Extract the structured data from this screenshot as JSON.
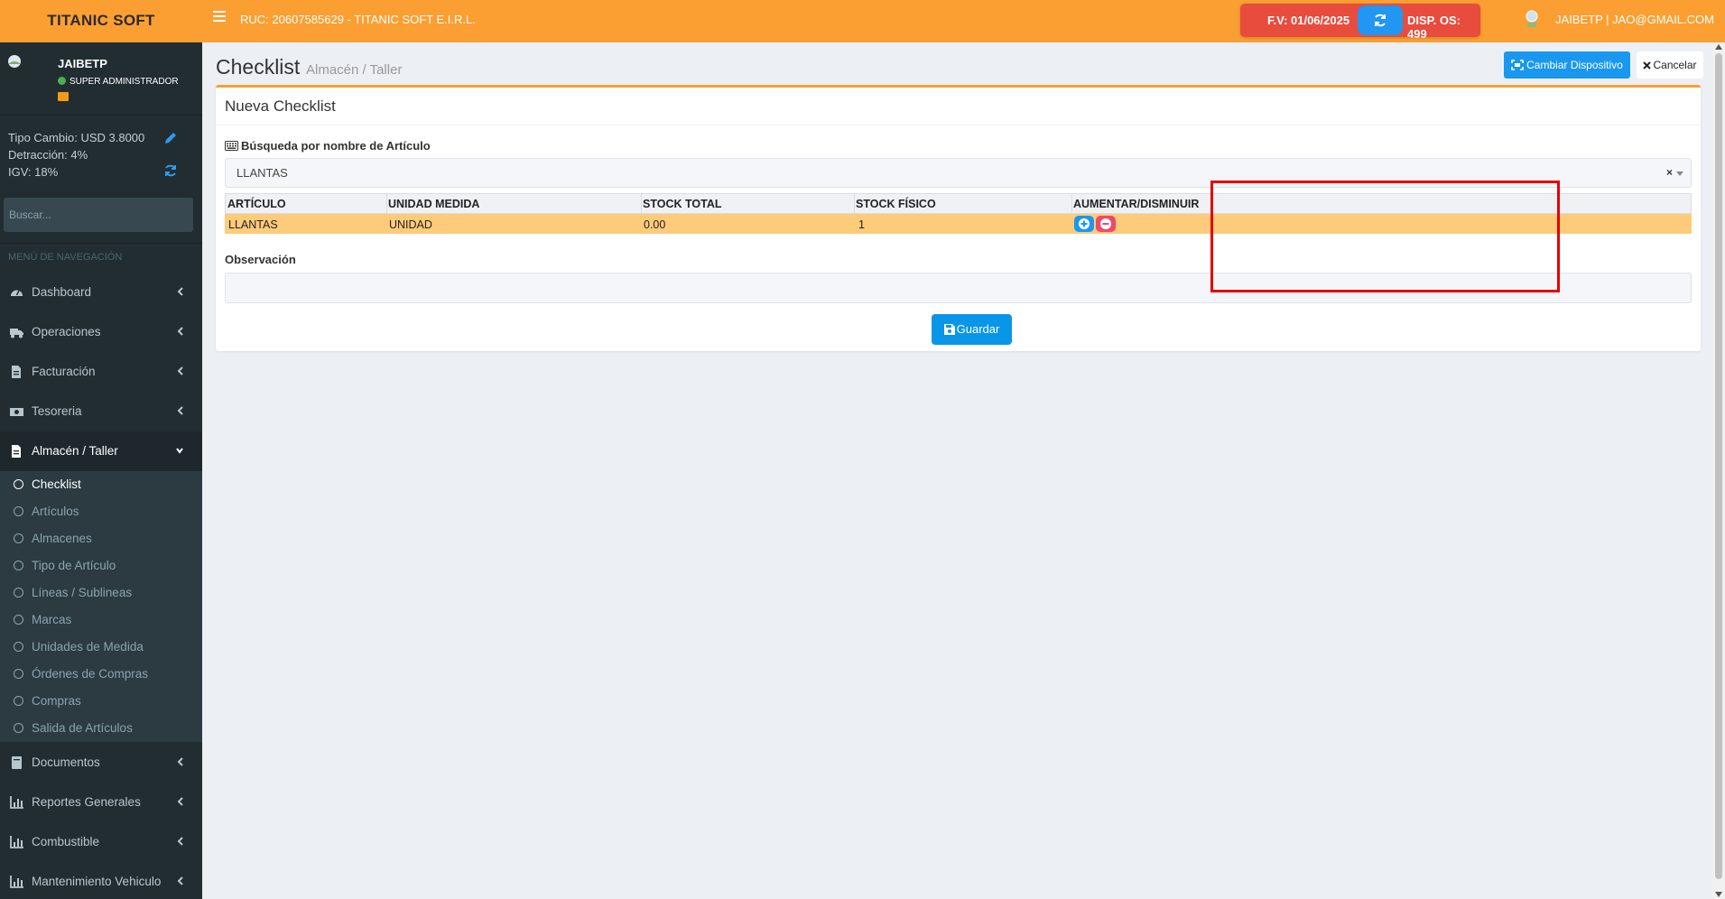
{
  "header": {
    "logo": "TITANIC SOFT",
    "ruc_text": "RUC: 20607585629 - TITANIC SOFT E.I.R.L.",
    "fv_text": "F.V:  01/06/2025",
    "disp_text": "DISP. OS:  499",
    "user_text": "JAIBETP | JAO@GMAIL.COM"
  },
  "sidebar": {
    "user_name": "JAIBETP",
    "user_role": "SUPER ADMINISTRADOR",
    "tipo_cambio": "Tipo Cambio: USD 3.8000",
    "detraccion": "Detracción: 4%",
    "igv": "IGV: 18%",
    "search_placeholder": "Buscar...",
    "nav_header": "MENÚ DE NAVEGACIÓN",
    "items": [
      {
        "label": "Dashboard",
        "icon": "dashboard-icon"
      },
      {
        "label": "Operaciones",
        "icon": "truck-icon"
      },
      {
        "label": "Facturación",
        "icon": "file-icon"
      },
      {
        "label": "Tesoreria",
        "icon": "money-icon"
      },
      {
        "label": "Almacén / Taller",
        "icon": "file-icon"
      },
      {
        "label": "Documentos",
        "icon": "book-icon"
      },
      {
        "label": "Reportes Generales",
        "icon": "chart-icon"
      },
      {
        "label": "Combustible",
        "icon": "chart-icon"
      },
      {
        "label": "Mantenimiento Vehiculo",
        "icon": "chart-icon"
      }
    ],
    "subitems": [
      "Checklist",
      "Artículos",
      "Almacenes",
      "Tipo de Artículo",
      "Líneas / Sublineas",
      "Marcas",
      "Unidades de Medida",
      "Órdenes de Compras",
      "Compras",
      "Salida de Artículos"
    ]
  },
  "page": {
    "title": "Checklist",
    "subtitle": "Almacén / Taller",
    "btn_cambiar": "Cambiar Dispositivo",
    "btn_cancelar": "Cancelar"
  },
  "form": {
    "box_title": "Nueva Checklist",
    "search_label": "Búsqueda por nombre de Artículo",
    "selected_value": "LLANTAS",
    "clear_symbol": "×",
    "observacion_label": "Observación",
    "observacion_value": "",
    "guardar_label": "Guardar"
  },
  "table": {
    "headers": [
      "ARTÍCULO",
      "UNIDAD MEDIDA",
      "STOCK TOTAL",
      "STOCK FÍSICO",
      "AUMENTAR/DISMINUIR"
    ],
    "rows": [
      [
        "LLANTAS",
        "UNIDAD",
        "0.00",
        "1"
      ]
    ]
  },
  "colors": {
    "header_bg": "#fb9f33",
    "sidebar_bg": "#222d32",
    "row_highlight": "#fecb7a",
    "primary_button": "#0a96e8",
    "danger": "#e84c3d",
    "plus_button": "#1a98f0",
    "minus_button": "#ee4a6a",
    "annotation_red": "#e60000"
  }
}
